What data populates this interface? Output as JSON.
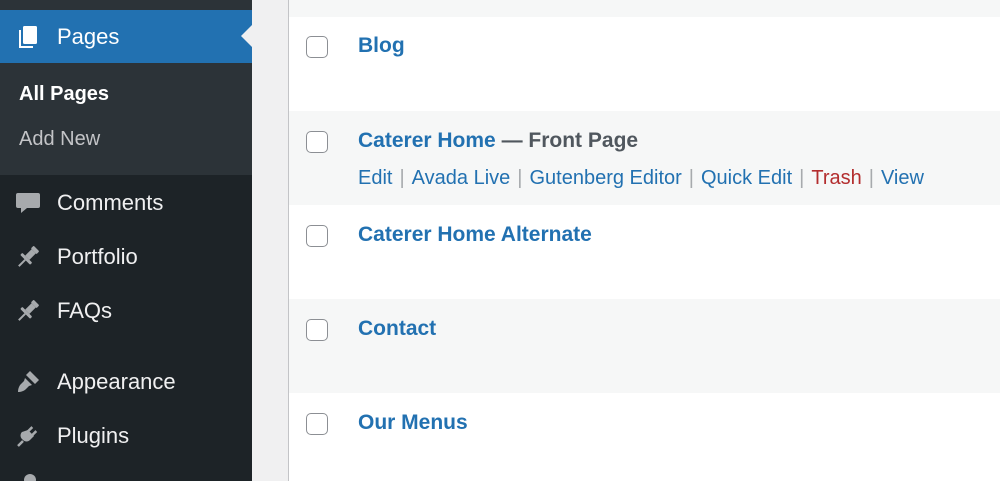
{
  "sidebar": {
    "active_menu": {
      "label": "Pages",
      "icon": "pages-icon"
    },
    "submenu": [
      {
        "label": "All Pages",
        "current": true
      },
      {
        "label": "Add New",
        "current": false
      }
    ],
    "items": [
      {
        "label": "Comments",
        "icon": "comments-icon"
      },
      {
        "label": "Portfolio",
        "icon": "pin-icon"
      },
      {
        "label": "FAQs",
        "icon": "pin-icon"
      },
      {
        "label": "Appearance",
        "icon": "paintbrush-icon"
      },
      {
        "label": "Plugins",
        "icon": "plugin-icon"
      }
    ]
  },
  "pages_list": {
    "rows": [
      {
        "title": "Blog"
      },
      {
        "title": "Caterer Home",
        "state": " — Front Page"
      },
      {
        "title": "Caterer Home Alternate"
      },
      {
        "title": "Contact"
      },
      {
        "title": "Our Menus"
      }
    ],
    "row_actions": {
      "edit": "Edit",
      "avada_live": "Avada Live",
      "gutenberg_editor": "Gutenberg Editor",
      "quick_edit": "Quick Edit",
      "trash": "Trash",
      "view": "View",
      "separator": "|"
    }
  },
  "colors": {
    "sidebar_bg": "#1d2327",
    "submenu_bg": "#2c3338",
    "accent": "#2271b1",
    "trash": "#b32d2e",
    "row_alt": "#f6f7f7"
  }
}
